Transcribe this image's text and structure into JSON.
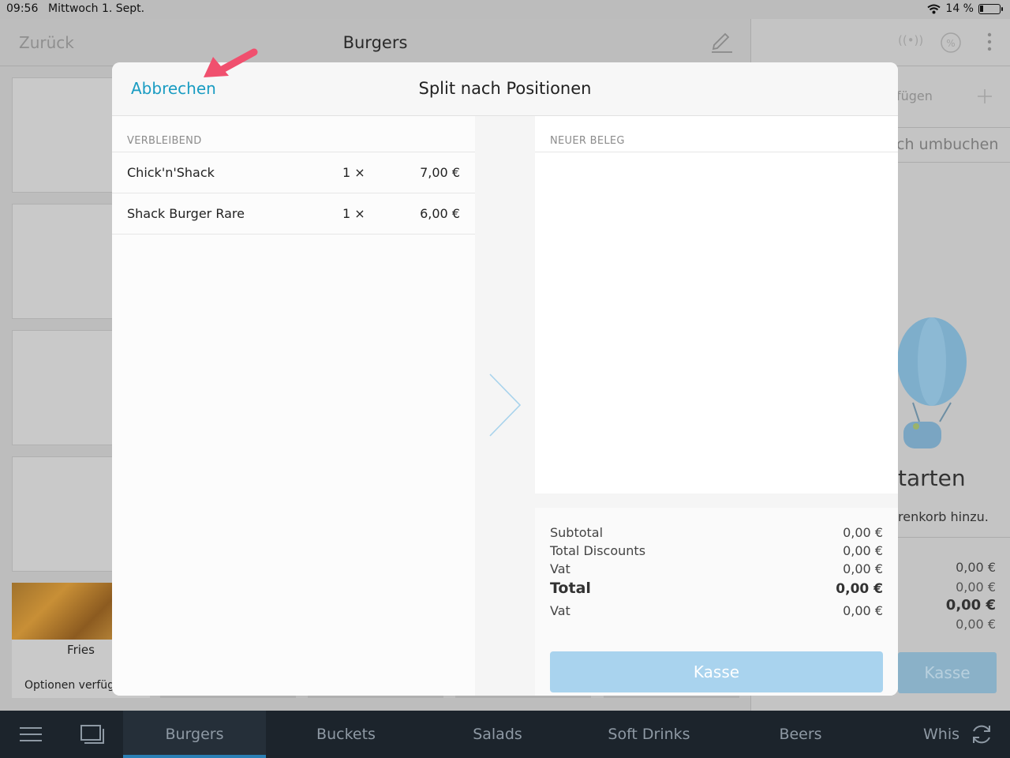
{
  "status_bar": {
    "time": "09:56",
    "date": "Mittwoch 1. Sept.",
    "battery": "14 %"
  },
  "navbar": {
    "back_label": "Zurück",
    "title": "Burgers"
  },
  "right_panel": {
    "row1_text": "fügen",
    "row2_text": "ch umbuchen",
    "heading_partial": "tarten",
    "sub_partial": "renkorb hinzu.",
    "amounts": [
      "0,00 €",
      "0,00 €",
      "0,00 €",
      "0,00 €"
    ],
    "kasse_label": "Kasse"
  },
  "product_grid": {
    "fries_label": "Fries",
    "fries_options": "Optionen verfüg"
  },
  "tabbar": {
    "tabs": [
      "Burgers",
      "Buckets",
      "Salads",
      "Soft Drinks",
      "Beers",
      "Whis"
    ],
    "active": "Burgers"
  },
  "modal": {
    "cancel_label": "Abbrechen",
    "title": "Split nach Positionen",
    "remaining": {
      "header": "VERBLEIBEND",
      "items": [
        {
          "name": "Chick'n'Shack",
          "qty": "1 ×",
          "price": "7,00 €"
        },
        {
          "name": "Shack Burger Rare",
          "qty": "1 ×",
          "price": "6,00 €"
        }
      ]
    },
    "new_receipt": {
      "header": "NEUER BELEG"
    },
    "totals": {
      "subtotal_label": "Subtotal",
      "subtotal": "0,00 €",
      "discounts_label": "Total Discounts",
      "discounts": "0,00 €",
      "vat_label": "Vat",
      "vat": "0,00 €",
      "total_label": "Total",
      "total": "0,00 €",
      "vat2_label": "Vat",
      "vat2": "0,00 €"
    },
    "kasse_label": "Kasse"
  },
  "colors": {
    "accent": "#1a9cc2",
    "kasse_button": "#a9d3ee",
    "annotation_arrow": "#f0506e",
    "tabbar_bg": "#1c242c"
  }
}
